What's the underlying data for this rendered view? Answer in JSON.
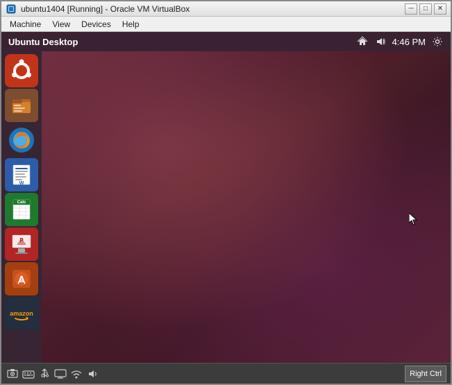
{
  "window": {
    "title": "ubuntu1404 [Running] - Oracle VM VirtualBox",
    "title_icon": "virtualbox-icon",
    "controls": {
      "minimize": "─",
      "maximize": "□",
      "close": "✕"
    }
  },
  "menubar": {
    "items": [
      "Machine",
      "View",
      "Devices",
      "Help"
    ]
  },
  "ubuntu_topbar": {
    "title": "Ubuntu Desktop",
    "time": "4:46 PM",
    "icons": [
      "network-icon",
      "volume-icon",
      "settings-icon"
    ]
  },
  "launcher": {
    "icons": [
      {
        "name": "ubuntu-home-icon",
        "label": "Ubuntu"
      },
      {
        "name": "files-icon",
        "label": "Files"
      },
      {
        "name": "firefox-icon",
        "label": "Firefox"
      },
      {
        "name": "writer-icon",
        "label": "LibreOffice Writer"
      },
      {
        "name": "calc-icon",
        "label": "LibreOffice Calc"
      },
      {
        "name": "impress-icon",
        "label": "LibreOffice Impress"
      },
      {
        "name": "appstore-icon",
        "label": "App Store"
      },
      {
        "name": "amazon-icon",
        "label": "Amazon"
      }
    ]
  },
  "statusbar": {
    "right_ctrl_label": "Right Ctrl",
    "icons": [
      "screenshot-icon",
      "keyboard-icon",
      "usb-icon",
      "display-icon",
      "network-status-icon",
      "audio-status-icon"
    ]
  }
}
